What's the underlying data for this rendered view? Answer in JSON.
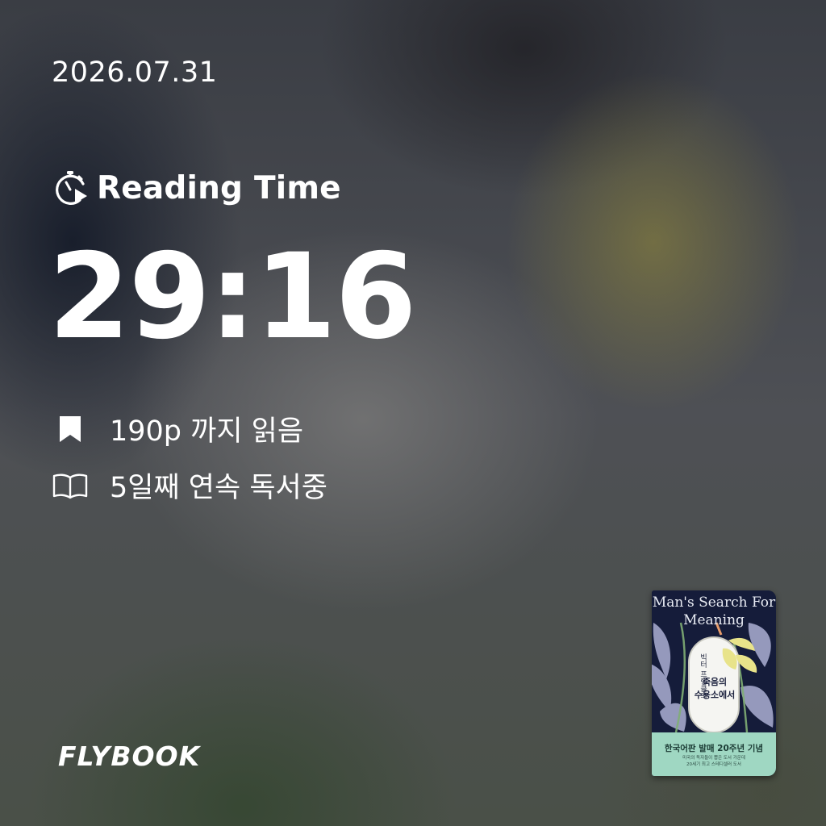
{
  "date": "2026.07.31",
  "reading_time": {
    "label": "Reading Time",
    "icon": "stopwatch-play-icon",
    "value": "29:16"
  },
  "stats": [
    {
      "icon": "bookmark-icon",
      "text": "190p 까지 읽음"
    },
    {
      "icon": "open-book-icon",
      "text": "5일째 연속 독서중"
    }
  ],
  "brand": "FLYBOOK",
  "book_cover": {
    "title_line1": "Man's Search For",
    "title_line2": "Meaning",
    "subtitle": "빅터 프랭클의",
    "korean_title_line1": "죽음의",
    "korean_title_line2": "수용소에서",
    "band_title": "한국어판 발매 20주년 기념",
    "band_sub_line1": "미국의 독자들이 뽑은 도서 가운데",
    "band_sub_line2": "20세기 최고 스테디셀러 도서",
    "colors": {
      "cover_bg": "#151c3a",
      "band": "#9fd7c2",
      "flower": "#e8e38a"
    }
  }
}
